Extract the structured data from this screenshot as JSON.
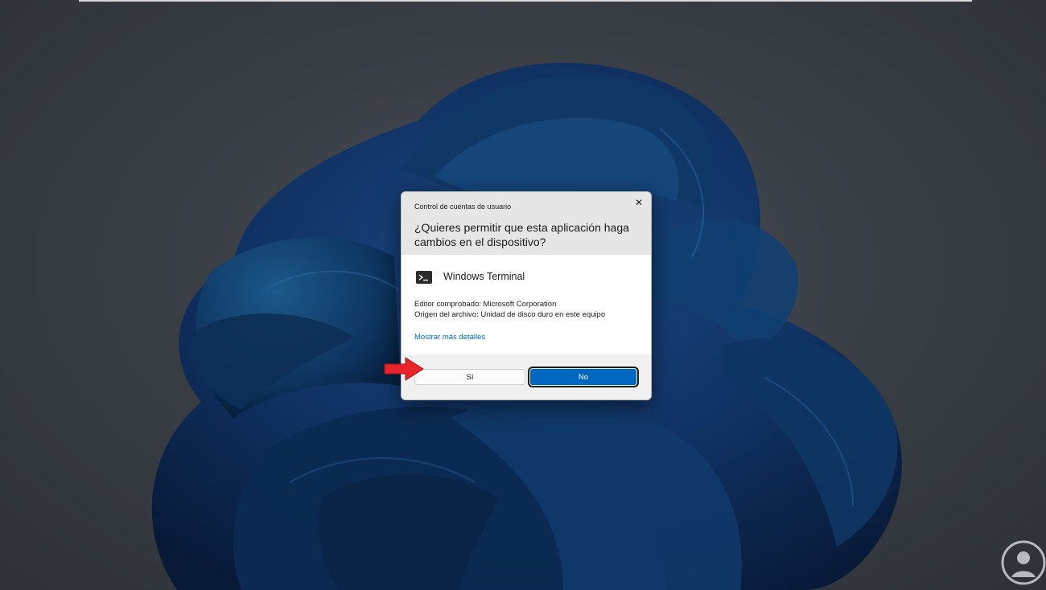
{
  "dialog": {
    "caption": "Control de cuentas de usuario",
    "question": "¿Quieres permitir que esta aplicación haga cambios en el dispositivo?",
    "app_name": "Windows Terminal",
    "publisher_line": "Editor comprobado: Microsoft Corporation",
    "origin_line": "Origen del archivo: Unidad de disco duro en este equipo",
    "details_link": "Mostrar más detalles",
    "yes_label": "Sí",
    "no_label": "No",
    "close_glyph": "✕",
    "app_icon": "terminal-icon"
  },
  "colors": {
    "accent": "#0067c0",
    "arrow": "#e8232a"
  },
  "annotation": {
    "icon": "red-arrow-icon"
  },
  "watermark": {
    "icon": "solvetic-logo-icon"
  }
}
